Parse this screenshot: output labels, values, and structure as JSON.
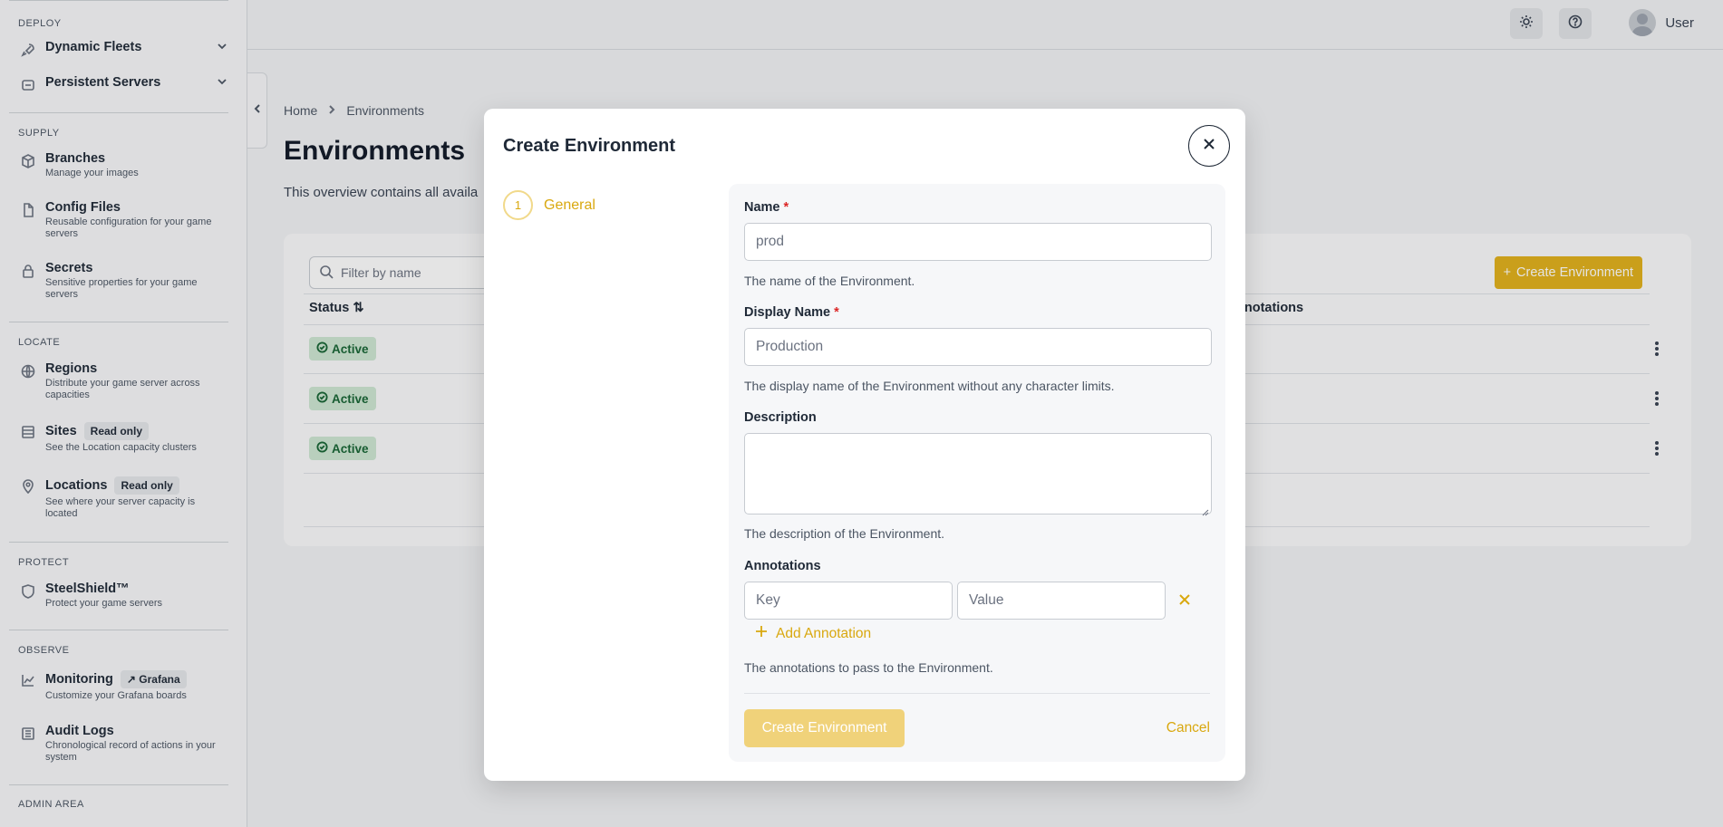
{
  "sidebar": {
    "sections": {
      "deploy": "DEPLOY",
      "supply": "SUPPLY",
      "locate": "LOCATE",
      "protect": "PROTECT",
      "observe": "OBSERVE",
      "admin": "ADMIN AREA"
    },
    "items": {
      "dynamic_fleets": {
        "label": "Dynamic Fleets"
      },
      "persistent_servers": {
        "label": "Persistent Servers"
      },
      "branches": {
        "label": "Branches",
        "sub": "Manage your images"
      },
      "config_files": {
        "label": "Config Files",
        "sub": "Reusable configuration for your game servers"
      },
      "secrets": {
        "label": "Secrets",
        "sub": "Sensitive properties for your game servers"
      },
      "regions": {
        "label": "Regions",
        "sub": "Distribute your game server across capacities"
      },
      "sites": {
        "label": "Sites",
        "badge": "Read only",
        "sub": "See the Location capacity clusters"
      },
      "locations": {
        "label": "Locations",
        "badge": "Read only",
        "sub": "See where your server capacity is located"
      },
      "steelshield": {
        "label": "SteelShield™",
        "sub": "Protect your game servers"
      },
      "monitoring": {
        "label": "Monitoring",
        "badge": "Grafana",
        "sub": "Customize your Grafana boards"
      },
      "audit_logs": {
        "label": "Audit Logs",
        "sub": "Chronological record of actions in your system"
      }
    }
  },
  "topbar": {
    "user": "User"
  },
  "breadcrumb": {
    "home": "Home",
    "current": "Environments"
  },
  "page": {
    "title": "Environments",
    "description": "This overview contains all availa",
    "filter_placeholder": "Filter by name",
    "create_button": "Create Environment",
    "col_status": "Status",
    "col_annotations": "nnotations",
    "rows": [
      {
        "status": "Active"
      },
      {
        "status": "Active"
      },
      {
        "status": "Active"
      }
    ]
  },
  "modal": {
    "title": "Create Environment",
    "step_number": "1",
    "step_label": "General",
    "name_label": "Name",
    "name_required": "*",
    "name_value": "prod",
    "name_help": "The name of the Environment.",
    "display_label": "Display Name",
    "display_required": "*",
    "display_placeholder": "Production",
    "display_help": "The display name of the Environment without any character limits.",
    "description_label": "Description",
    "description_help": "The description of the Environment.",
    "annotations_label": "Annotations",
    "key_placeholder": "Key",
    "value_placeholder": "Value",
    "add_annotation": "Add Annotation",
    "annotations_help": "The annotations to pass to the Environment.",
    "submit": "Create Environment",
    "cancel": "Cancel"
  },
  "colors": {
    "accent": "#e2b11b",
    "accent_text": "#d9a80f",
    "active_bg": "#cfe8d3",
    "active_text": "#166534"
  }
}
